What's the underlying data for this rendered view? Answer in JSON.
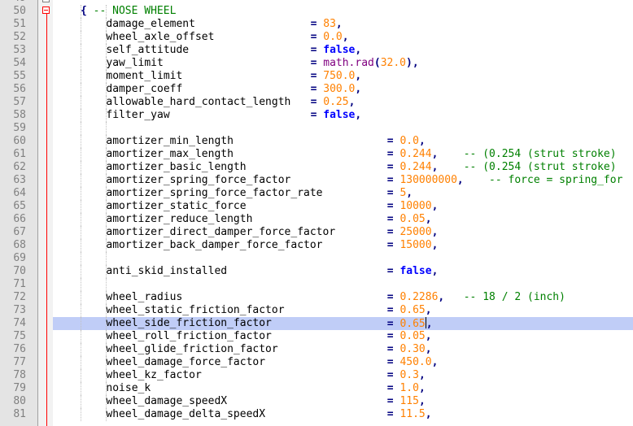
{
  "editor": {
    "top_partial_number": "49",
    "lines": [
      {
        "n": "50",
        "tokens": [
          {
            "c": "op",
            "v": "{ "
          },
          {
            "c": "cm",
            "v": "-- NOSE WHEEL"
          }
        ],
        "col": 4
      },
      {
        "n": "51",
        "tokens": [
          {
            "c": "id",
            "v": "damage_element"
          }
        ],
        "eqcol": 36,
        "val": [
          {
            "c": "num",
            "v": "83"
          },
          {
            "c": "op",
            "v": ","
          }
        ]
      },
      {
        "n": "52",
        "tokens": [
          {
            "c": "id",
            "v": "wheel_axle_offset"
          }
        ],
        "eqcol": 36,
        "val": [
          {
            "c": "num",
            "v": "0.0"
          },
          {
            "c": "op",
            "v": ","
          }
        ]
      },
      {
        "n": "53",
        "tokens": [
          {
            "c": "id",
            "v": "self_attitude"
          }
        ],
        "eqcol": 36,
        "val": [
          {
            "c": "kw",
            "v": "false"
          },
          {
            "c": "op",
            "v": ","
          }
        ]
      },
      {
        "n": "54",
        "tokens": [
          {
            "c": "id",
            "v": "yaw_limit"
          }
        ],
        "eqcol": 36,
        "val": [
          {
            "c": "fn",
            "v": "math.rad"
          },
          {
            "c": "op",
            "v": "("
          },
          {
            "c": "num",
            "v": "32.0"
          },
          {
            "c": "op",
            "v": "),"
          }
        ]
      },
      {
        "n": "55",
        "tokens": [
          {
            "c": "id",
            "v": "moment_limit"
          }
        ],
        "eqcol": 36,
        "val": [
          {
            "c": "num",
            "v": "750.0"
          },
          {
            "c": "op",
            "v": ","
          }
        ]
      },
      {
        "n": "56",
        "tokens": [
          {
            "c": "id",
            "v": "damper_coeff"
          }
        ],
        "eqcol": 36,
        "val": [
          {
            "c": "num",
            "v": "300.0"
          },
          {
            "c": "op",
            "v": ","
          }
        ]
      },
      {
        "n": "57",
        "tokens": [
          {
            "c": "id",
            "v": "allowable_hard_contact_length"
          }
        ],
        "eqcol": 36,
        "val": [
          {
            "c": "num",
            "v": "0.25"
          },
          {
            "c": "op",
            "v": ","
          }
        ]
      },
      {
        "n": "58",
        "tokens": [
          {
            "c": "id",
            "v": "filter_yaw"
          }
        ],
        "eqcol": 36,
        "val": [
          {
            "c": "kw",
            "v": "false"
          },
          {
            "c": "op",
            "v": ","
          }
        ]
      },
      {
        "n": "59",
        "tokens": []
      },
      {
        "n": "60",
        "tokens": [
          {
            "c": "id",
            "v": "amortizer_min_length"
          }
        ],
        "eqcol": 48,
        "val": [
          {
            "c": "num",
            "v": "0.0"
          },
          {
            "c": "op",
            "v": ","
          }
        ]
      },
      {
        "n": "61",
        "tokens": [
          {
            "c": "id",
            "v": "amortizer_max_length"
          }
        ],
        "eqcol": 48,
        "val": [
          {
            "c": "num",
            "v": "0.244"
          },
          {
            "c": "op",
            "v": ","
          },
          {
            "c": "cm",
            "v": "    -- (0.254 (strut stroke)"
          }
        ]
      },
      {
        "n": "62",
        "tokens": [
          {
            "c": "id",
            "v": "amortizer_basic_length"
          }
        ],
        "eqcol": 48,
        "val": [
          {
            "c": "num",
            "v": "0.244"
          },
          {
            "c": "op",
            "v": ","
          },
          {
            "c": "cm",
            "v": "    -- (0.254 (strut stroke)"
          }
        ]
      },
      {
        "n": "63",
        "tokens": [
          {
            "c": "id",
            "v": "amortizer_spring_force_factor"
          }
        ],
        "eqcol": 48,
        "val": [
          {
            "c": "num",
            "v": "130000000"
          },
          {
            "c": "op",
            "v": ","
          },
          {
            "c": "cm",
            "v": "    -- force = spring_for"
          }
        ]
      },
      {
        "n": "64",
        "tokens": [
          {
            "c": "id",
            "v": "amortizer_spring_force_factor_rate"
          }
        ],
        "eqcol": 48,
        "val": [
          {
            "c": "num",
            "v": "5"
          },
          {
            "c": "op",
            "v": ","
          }
        ]
      },
      {
        "n": "65",
        "tokens": [
          {
            "c": "id",
            "v": "amortizer_static_force"
          }
        ],
        "eqcol": 48,
        "val": [
          {
            "c": "num",
            "v": "10000"
          },
          {
            "c": "op",
            "v": ","
          }
        ]
      },
      {
        "n": "66",
        "tokens": [
          {
            "c": "id",
            "v": "amortizer_reduce_length"
          }
        ],
        "eqcol": 48,
        "val": [
          {
            "c": "num",
            "v": "0.05"
          },
          {
            "c": "op",
            "v": ","
          }
        ]
      },
      {
        "n": "67",
        "tokens": [
          {
            "c": "id",
            "v": "amortizer_direct_damper_force_factor"
          }
        ],
        "eqcol": 48,
        "val": [
          {
            "c": "num",
            "v": "25000"
          },
          {
            "c": "op",
            "v": ","
          }
        ]
      },
      {
        "n": "68",
        "tokens": [
          {
            "c": "id",
            "v": "amortizer_back_damper_force_factor"
          }
        ],
        "eqcol": 48,
        "val": [
          {
            "c": "num",
            "v": "15000"
          },
          {
            "c": "op",
            "v": ","
          }
        ]
      },
      {
        "n": "69",
        "tokens": []
      },
      {
        "n": "70",
        "tokens": [
          {
            "c": "id",
            "v": "anti_skid_installed"
          }
        ],
        "eqcol": 48,
        "val": [
          {
            "c": "kw",
            "v": "false"
          },
          {
            "c": "op",
            "v": ","
          }
        ]
      },
      {
        "n": "71",
        "tokens": []
      },
      {
        "n": "72",
        "tokens": [
          {
            "c": "id",
            "v": "wheel_radius"
          }
        ],
        "eqcol": 48,
        "val": [
          {
            "c": "num",
            "v": "0.2286"
          },
          {
            "c": "op",
            "v": ","
          },
          {
            "c": "cm",
            "v": "   -- 18 / 2 (inch)"
          }
        ]
      },
      {
        "n": "73",
        "tokens": [
          {
            "c": "id",
            "v": "wheel_static_friction_factor"
          }
        ],
        "eqcol": 48,
        "val": [
          {
            "c": "num",
            "v": "0.65"
          },
          {
            "c": "op",
            "v": ","
          }
        ]
      },
      {
        "n": "74",
        "tokens": [
          {
            "c": "id",
            "v": "wheel_side_friction_factor"
          }
        ],
        "eqcol": 48,
        "val": [
          {
            "c": "num",
            "v": "0.65"
          },
          {
            "c": "op",
            "v": ","
          }
        ],
        "current": true
      },
      {
        "n": "75",
        "tokens": [
          {
            "c": "id",
            "v": "wheel_roll_friction_factor"
          }
        ],
        "eqcol": 48,
        "val": [
          {
            "c": "num",
            "v": "0.05"
          },
          {
            "c": "op",
            "v": ","
          }
        ]
      },
      {
        "n": "76",
        "tokens": [
          {
            "c": "id",
            "v": "wheel_glide_friction_factor"
          }
        ],
        "eqcol": 48,
        "val": [
          {
            "c": "num",
            "v": "0.30"
          },
          {
            "c": "op",
            "v": ","
          }
        ]
      },
      {
        "n": "77",
        "tokens": [
          {
            "c": "id",
            "v": "wheel_damage_force_factor"
          }
        ],
        "eqcol": 48,
        "val": [
          {
            "c": "num",
            "v": "450.0"
          },
          {
            "c": "op",
            "v": ","
          }
        ]
      },
      {
        "n": "78",
        "tokens": [
          {
            "c": "id",
            "v": "wheel_kz_factor"
          }
        ],
        "eqcol": 48,
        "val": [
          {
            "c": "num",
            "v": "0.3"
          },
          {
            "c": "op",
            "v": ","
          }
        ]
      },
      {
        "n": "79",
        "tokens": [
          {
            "c": "id",
            "v": "noise_k"
          }
        ],
        "eqcol": 48,
        "val": [
          {
            "c": "num",
            "v": "1.0"
          },
          {
            "c": "op",
            "v": ","
          }
        ]
      },
      {
        "n": "80",
        "tokens": [
          {
            "c": "id",
            "v": "wheel_damage_speedX"
          }
        ],
        "eqcol": 48,
        "val": [
          {
            "c": "num",
            "v": "115"
          },
          {
            "c": "op",
            "v": ","
          }
        ]
      },
      {
        "n": "81",
        "tokens": [
          {
            "c": "id",
            "v": "wheel_damage_delta_speedX"
          }
        ],
        "eqcol": 48,
        "val": [
          {
            "c": "num",
            "v": "11.5"
          },
          {
            "c": "op",
            "v": ","
          }
        ]
      }
    ]
  },
  "colors": {
    "current_line": "#c0cdf7",
    "keyword": "#0000ff",
    "number": "#ff8000",
    "comment": "#008000",
    "operator": "#000080",
    "function": "#800080",
    "fold_marker": "#ff0000"
  },
  "icons": {
    "fold_collapse": "fold-minus-icon"
  }
}
